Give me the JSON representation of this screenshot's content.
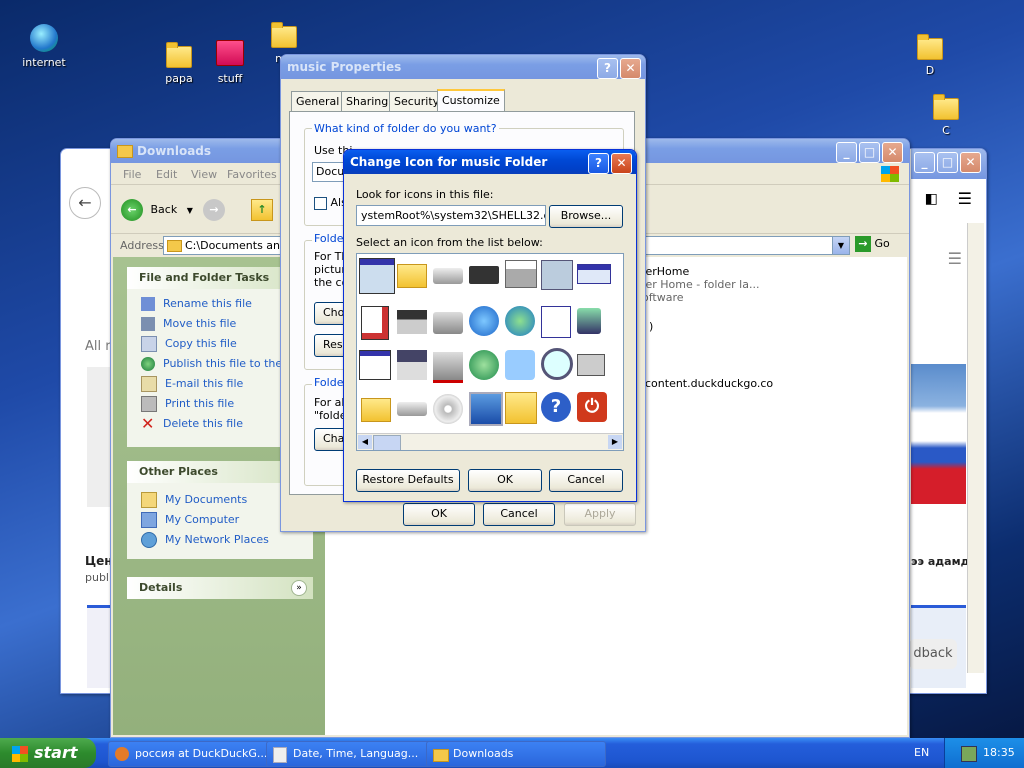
{
  "desktop": {
    "icons": [
      {
        "label": "internet"
      },
      {
        "label": "papa"
      },
      {
        "label": "stuff"
      },
      {
        "label": "mu"
      },
      {
        "label": "D"
      },
      {
        "label": "C"
      }
    ]
  },
  "browser": {
    "url_suffix": "Go",
    "search_hint": "All r",
    "results": [
      {
        "title": "Цен",
        "sub": "publ"
      },
      {
        "title": "rkerHome",
        "sub": "rker Home - folder la..."
      },
      {
        "title": "Software",
        "sub": "content.duckduckgo.co"
      },
      {
        "title": "ээ адамд",
        "sub": "dback"
      }
    ],
    "result_paren": ")"
  },
  "explorer": {
    "title": "Downloads",
    "menu": [
      "File",
      "Edit",
      "View",
      "Favorites"
    ],
    "back_label": "Back",
    "address_label": "Address",
    "address_value": "C:\\Documents and S",
    "go_label": "Go",
    "tasks_header": "File and Folder Tasks",
    "tasks": [
      "Rename this file",
      "Move this file",
      "Copy this file",
      "Publish this file to the We",
      "E-mail this file",
      "Print this file",
      "Delete this file"
    ],
    "places_header": "Other Places",
    "places": [
      "My Documents",
      "My Computer",
      "My Network Places"
    ],
    "details_header": "Details"
  },
  "properties": {
    "title": "music Properties",
    "tabs": [
      "General",
      "Sharing",
      "Security",
      "Customize"
    ],
    "group1": "What kind of folder do you want?",
    "use_text": "Use thi",
    "select_value": "Docu",
    "also_text": "Als",
    "group2": "Folder",
    "group2_line1": "For Th",
    "group2_line2": "picture",
    "group2_line3": "the co",
    "choose": "Choo",
    "restore": "Res",
    "group3": "Folder",
    "group3_line1": "For all",
    "group3_line2": "\"folde",
    "change": "Cha",
    "ok": "OK",
    "cancel": "Cancel",
    "apply": "Apply"
  },
  "change_icon": {
    "title": "Change Icon for music Folder",
    "look_label": "Look for icons in this file:",
    "file_value": "ystemRoot%\\system32\\SHELL32.dll",
    "browse": "Browse...",
    "select_label": "Select an icon from the list below:",
    "restore": "Restore Defaults",
    "ok": "OK",
    "cancel": "Cancel"
  },
  "taskbar": {
    "start": "start",
    "buttons": [
      "россия at DuckDuckG...",
      "Date, Time, Languag...",
      "Downloads"
    ],
    "lang": "EN",
    "clock": "18:35"
  }
}
